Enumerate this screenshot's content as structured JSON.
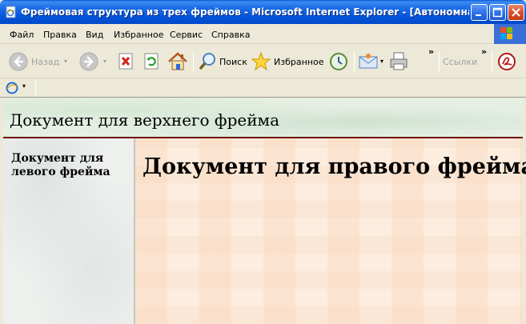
{
  "window": {
    "title": "Фреймовая структура из трех фреймов - Microsoft Internet Explorer - [Автономная ра..."
  },
  "menu": {
    "items": [
      "Файл",
      "Правка",
      "Вид",
      "Избранное",
      "Сервис",
      "Справка"
    ]
  },
  "toolbar": {
    "back_label": "Назад",
    "search_label": "Поиск",
    "favorites_label": "Избранное",
    "links_label": "Ссылки",
    "chevron": "»"
  },
  "frames": {
    "top_text": "Документ для верхнего фрейма",
    "left_text": "Документ для левого фрейма",
    "right_text": "Документ для правого фрейма"
  },
  "colors": {
    "titlebar": "#0355DA",
    "frame_divider": "#6E1410"
  }
}
